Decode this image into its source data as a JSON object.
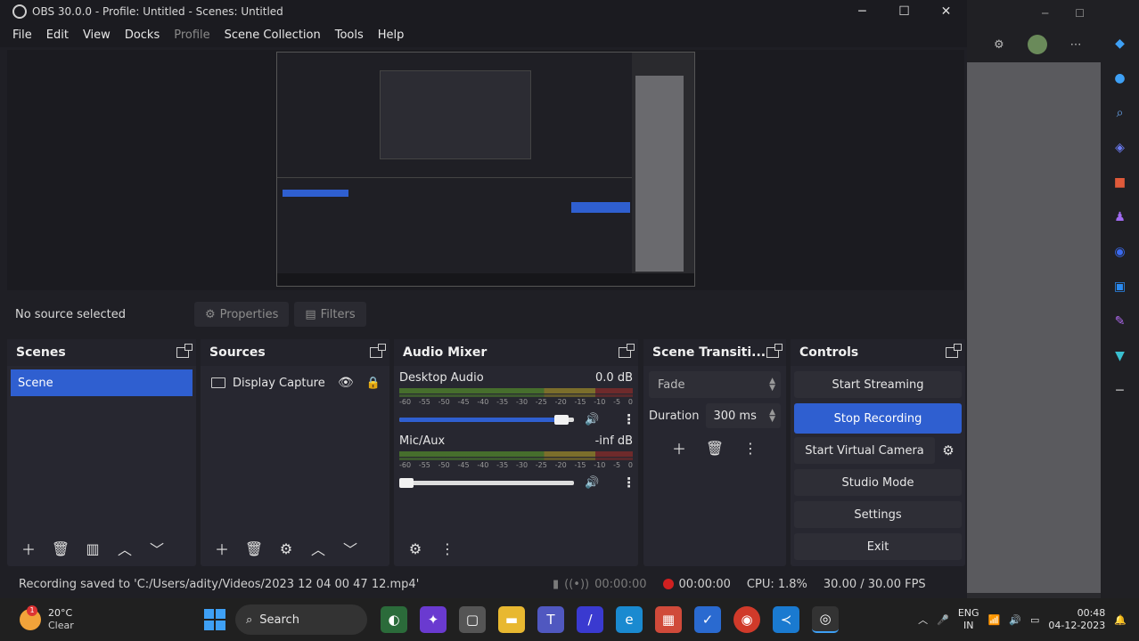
{
  "titlebar": {
    "title": "OBS 30.0.0 - Profile: Untitled - Scenes: Untitled",
    "minimize": "─",
    "maximize": "☐",
    "close": "✕"
  },
  "menu": [
    "File",
    "Edit",
    "View",
    "Docks",
    "Profile",
    "Scene Collection",
    "Tools",
    "Help"
  ],
  "source_bar": {
    "no_source": "No source selected",
    "properties": "Properties",
    "filters": "Filters"
  },
  "scenes": {
    "title": "Scenes",
    "items": [
      "Scene"
    ]
  },
  "sources": {
    "title": "Sources",
    "items": [
      {
        "name": "Display Capture"
      }
    ]
  },
  "mixer": {
    "title": "Audio Mixer",
    "scale": [
      "-60",
      "-55",
      "-50",
      "-45",
      "-40",
      "-35",
      "-30",
      "-25",
      "-20",
      "-15",
      "-10",
      "-5",
      "0"
    ],
    "channels": [
      {
        "name": "Desktop Audio",
        "level": "0.0 dB",
        "volume": 0.95
      },
      {
        "name": "Mic/Aux",
        "level": "-inf dB",
        "volume": 0.05
      }
    ]
  },
  "transitions": {
    "title": "Scene Transiti...",
    "selected": "Fade",
    "duration_label": "Duration",
    "duration_value": "300 ms"
  },
  "controls": {
    "title": "Controls",
    "start_streaming": "Start Streaming",
    "stop_recording": "Stop Recording",
    "start_virtual_camera": "Start Virtual Camera",
    "studio_mode": "Studio Mode",
    "settings": "Settings",
    "exit": "Exit"
  },
  "status": {
    "message": "Recording saved to 'C:/Users/adity/Videos/2023 12 04 00 47 12.mp4'",
    "stream_time": "00:00:00",
    "record_time": "00:00:00",
    "cpu": "CPU: 1.8%",
    "fps": "30.00 / 30.00 FPS"
  },
  "taskbar": {
    "weather_temp": "20°C",
    "weather_desc": "Clear",
    "search": "Search",
    "lang_top": "ENG",
    "lang_bottom": "IN",
    "time": "00:48",
    "date": "04-12-2023"
  },
  "colors": {
    "accent": "#2f5fd0",
    "panel": "#272730",
    "background": "#1f1f25"
  }
}
